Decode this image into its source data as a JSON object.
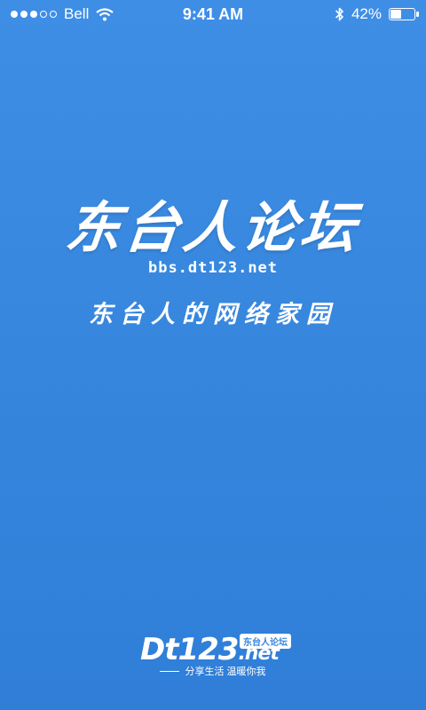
{
  "status_bar": {
    "carrier": "Bell",
    "time": "9:41 AM",
    "battery": "42%",
    "battery_level": 0.42,
    "icons": [
      "signal-dots-icon",
      "wifi-icon",
      "bluetooth-icon",
      "battery-icon"
    ]
  },
  "splash": {
    "title": "东台人论坛",
    "url": "bbs.dt123.net",
    "tagline": "东台人的网络家园"
  },
  "brand": {
    "logo_main": "Dt123",
    "logo_suffix": ".net",
    "badge": "东台人论坛",
    "slogan": "分享生活 温暖你我"
  },
  "colors": {
    "background_top": "#3f8ee6",
    "background_bottom": "#2f7ed8",
    "text": "#ffffff"
  }
}
